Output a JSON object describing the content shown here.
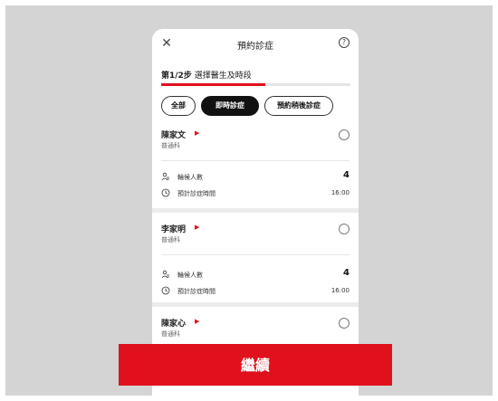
{
  "header": {
    "title": "預約診症",
    "close_icon": "close-icon",
    "help_icon": "help-icon",
    "help_glyph": "?"
  },
  "step": {
    "prefix": "第1/2步",
    "text": "選擇醫生及時段",
    "progress": 0.55
  },
  "filters": [
    {
      "label": "全部",
      "active": false
    },
    {
      "label": "即時診症",
      "active": true
    },
    {
      "label": "預約稍後診症",
      "active": false
    }
  ],
  "doctors": [
    {
      "name": "陳家文",
      "department": "普通科",
      "queue_label": "輪候人數",
      "queue_value": "4",
      "time_label": "預計診症時間",
      "time_value": "16:00"
    },
    {
      "name": "李家明",
      "department": "普通科",
      "queue_label": "輪候人數",
      "queue_value": "4",
      "time_label": "預計診症時間",
      "time_value": "16:00"
    },
    {
      "name": "陳家心",
      "department": "普通科"
    }
  ],
  "arrow_glyph": "▶",
  "continue_label": "繼續",
  "colors": {
    "accent": "#e0111d",
    "background": "#d4d4d4"
  }
}
